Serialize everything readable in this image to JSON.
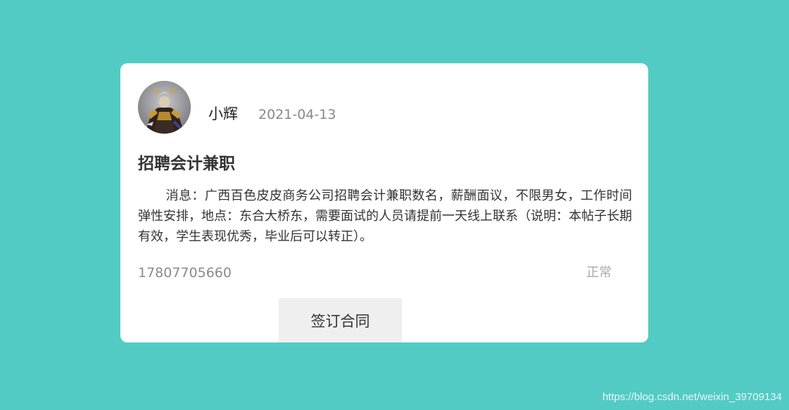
{
  "post": {
    "author": "小辉",
    "date": "2021-04-13",
    "title": "招聘会计兼职",
    "content": "消息：广西百色皮皮商务公司招聘会计兼职数名，薪酬面议，不限男女，工作时间弹性安排，地点：东合大桥东，需要面试的人员请提前一天线上联系（说明：本帖子长期有效，学生表现优秀，毕业后可以转正）。",
    "phone": "17807705660",
    "status": "正常",
    "action_label": "签订合同"
  },
  "watermark": "https://blog.csdn.net/weixin_39709134",
  "colors": {
    "page_background": "#52cbc4",
    "card_background": "#ffffff",
    "button_background": "#efefef"
  },
  "icons": {
    "avatar": "warrior-character-avatar"
  }
}
